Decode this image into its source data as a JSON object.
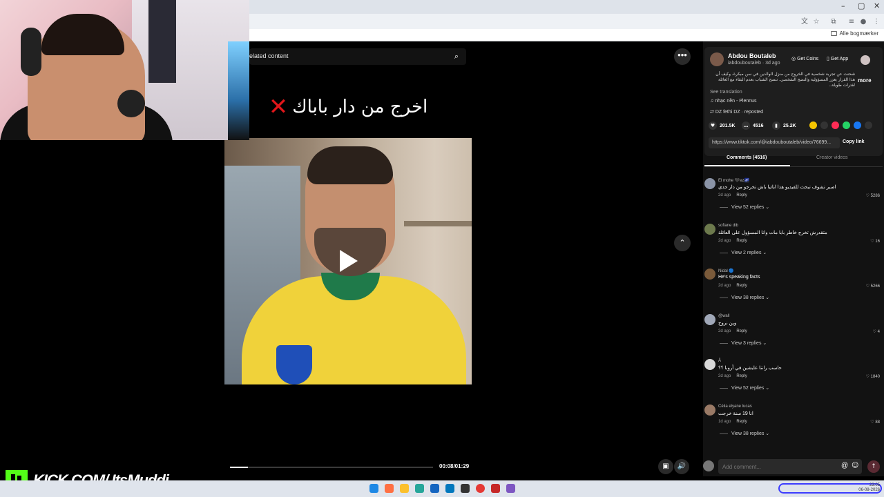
{
  "browser": {
    "window_controls": [
      "–",
      "▢",
      "✕"
    ],
    "bookmarks_label": "Alle bogmærker"
  },
  "video": {
    "search_text": "elated content",
    "caption": "اخرج من دار باباك",
    "caption_mark": "✕",
    "time": "00:08/01:29",
    "progress": 0.09
  },
  "post": {
    "author_name": "Abdou Boutaleb",
    "author_handle": "iabdouboutaleb · 3d ago",
    "get_coins": "Get Coins",
    "get_app": "Get App",
    "description": "شحنت عن تجربة شخصية في الخروج من منزل الوالدين في سن مبكرة، وكيف أن هذا القرار يعزز المسؤولية والنضج الشخصي. تنصح الشباب بعدم البقاء مع العائلة لفترات طويلة..",
    "more": "more",
    "see_translation": "See translation",
    "music": "nhạc nền - Plennus",
    "repost": "DZ fethi DZ · reposted",
    "likes": "201.5K",
    "comments": "4516",
    "saves": "25.2K",
    "link": "https://www.tiktok.com/@iabdouboutaleb/video/76699...",
    "copy_link": "Copy link",
    "tab_comments": "Comments (4516)",
    "tab_creator": "Creator videos"
  },
  "comments": [
    {
      "user": "El mohe 🖤ez🌌",
      "text": "اصبر تشوف تبحث للفيديو هذا ابائيا باش تخرجو من دار جدي",
      "age": "2d ago",
      "reply": "Reply",
      "likes": "5286",
      "view": "View 52 replies"
    },
    {
      "user": "sofiane dib",
      "text": "متقدرش تخرج خاطر بابا مات وانا المسؤول على العائلة",
      "age": "2d ago",
      "reply": "Reply",
      "likes": "16",
      "view": "View 2 replies"
    },
    {
      "user": "Nidal 🔵",
      "text": "He's speaking facts",
      "age": "2d ago",
      "reply": "Reply",
      "likes": "5266",
      "view": "View 38 replies"
    },
    {
      "user": "@wall",
      "text": "وين نروح",
      "age": "2d ago",
      "reply": "Reply",
      "likes": "4",
      "view": "View 3 replies"
    },
    {
      "user": "Å",
      "text": "حاسب راننا عايشين في أروبا ؟؟",
      "age": "2d ago",
      "reply": "Reply",
      "likes": "1840",
      "view": "View 52 replies"
    },
    {
      "user": "Célia elyane lucas",
      "text": "انا 19 سنة خرجت",
      "age": "1d ago",
      "reply": "Reply",
      "likes": "88",
      "view": "View 38 replies"
    }
  ],
  "add_comment_placeholder": "Add comment...",
  "kick": {
    "text": "KICK.COM/ ItsMuddi"
  },
  "clock": {
    "time": "23:05",
    "date": "06-08-2026"
  }
}
